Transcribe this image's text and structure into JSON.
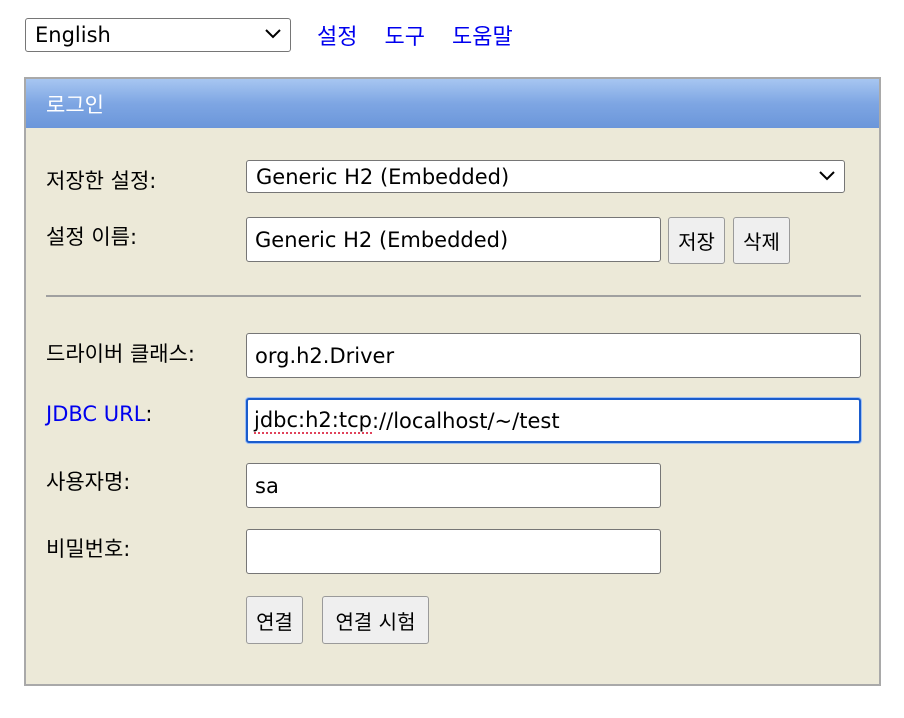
{
  "language": {
    "selected": "English"
  },
  "nav": {
    "settings": "설정",
    "tools": "도구",
    "help": "도움말"
  },
  "login": {
    "title": "로그인",
    "saved_settings_label": "저장한 설정:",
    "saved_settings_value": "Generic H2 (Embedded)",
    "setting_name_label": "설정 이름:",
    "setting_name_value": "Generic H2 (Embedded)",
    "save_button": "저장",
    "delete_button": "삭제",
    "driver_class_label": "드라이버 클래스:",
    "driver_class_value": "org.h2.Driver",
    "jdbc_url_label": "JDBC URL",
    "jdbc_url_colon": ":",
    "jdbc_url_value_prefix": "jdbc:h2:tcp",
    "jdbc_url_value_rest": "://localhost/~/test",
    "username_label": "사용자명:",
    "username_value": "sa",
    "password_label": "비밀번호:",
    "password_value": "",
    "connect_button": "연결",
    "test_connection_button": "연결 시험"
  },
  "colors": {
    "header": "#7ea6e3",
    "panel_bg": "#ece9d8",
    "link": "#0000ee"
  }
}
